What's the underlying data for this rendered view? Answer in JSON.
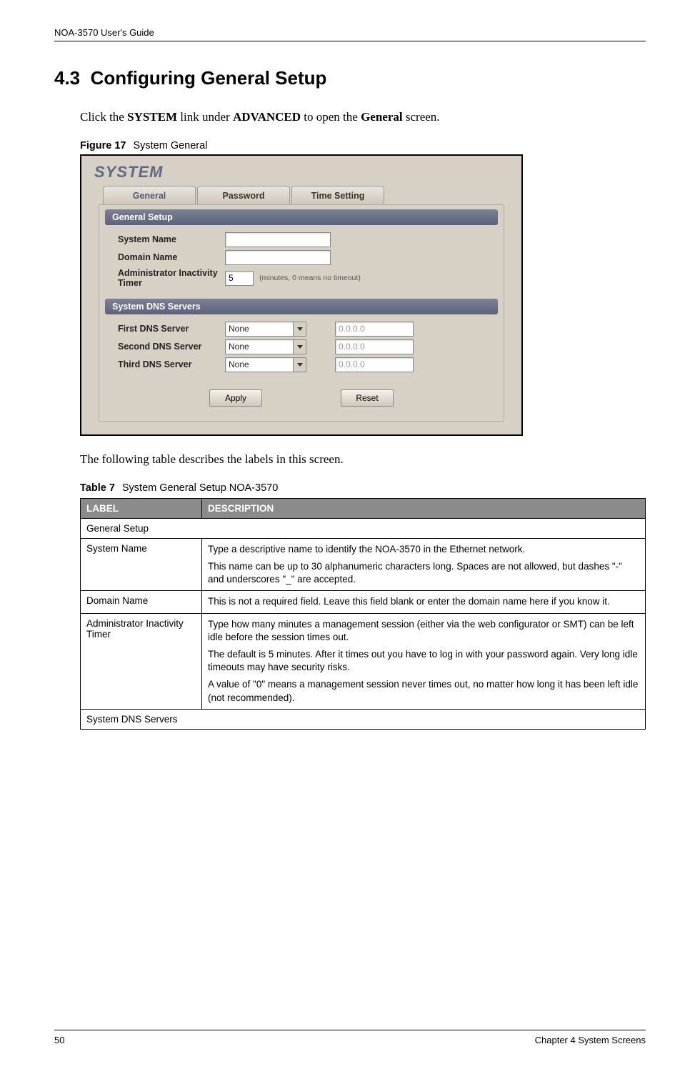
{
  "header": {
    "guide_title": "NOA-3570 User's Guide"
  },
  "section": {
    "number": "4.3",
    "title": "Configuring General Setup",
    "intro_pre": "Click the ",
    "intro_link1": "SYSTEM",
    "intro_mid1": " link under ",
    "intro_link2": "ADVANCED",
    "intro_mid2": " to open the ",
    "intro_link3": "General",
    "intro_post": " screen."
  },
  "figure": {
    "label": "Figure 17",
    "title": "System General"
  },
  "screenshot": {
    "heading": "SYSTEM",
    "tabs": {
      "general": "General",
      "password": "Password",
      "time": "Time Setting"
    },
    "sections": {
      "general_setup": "General Setup",
      "dns": "System DNS Servers"
    },
    "labels": {
      "system_name": "System Name",
      "domain_name": "Domain Name",
      "inactivity": "Administrator Inactivity Timer",
      "first_dns": "First DNS Server",
      "second_dns": "Second DNS Server",
      "third_dns": "Third DNS Server"
    },
    "values": {
      "inactivity": "5",
      "dns_select": "None",
      "dns_ip": "0.0.0.0"
    },
    "hint": "(minutes, 0 means no timeout)",
    "buttons": {
      "apply": "Apply",
      "reset": "Reset"
    }
  },
  "para_after_fig": "The following table describes the labels in this screen.",
  "table": {
    "label": "Table 7",
    "title": "System General Setup NOA-3570",
    "head": {
      "label": "LABEL",
      "desc": "DESCRIPTION"
    },
    "rows": {
      "r0": {
        "l": "General Setup"
      },
      "r1": {
        "l": "System Name",
        "d1": "Type a descriptive name to identify the NOA-3570 in the Ethernet network.",
        "d2": "This name can be up to 30 alphanumeric characters long. Spaces are not allowed, but dashes \"-\" and underscores \"_\" are accepted."
      },
      "r2": {
        "l": "Domain Name",
        "d1": "This is not a required field. Leave this field blank or enter the domain name here if you know it."
      },
      "r3": {
        "l": "Administrator Inactivity Timer",
        "d1": "Type how many minutes a management session (either via the web configurator or SMT) can be left idle before the session times out.",
        "d2": "The default is 5 minutes. After it times out you have to log in with your password again. Very long idle timeouts may have security risks.",
        "d3": "A value of \"0\" means a management session never times out, no matter how long it has been left idle (not recommended)."
      },
      "r4": {
        "l": "System DNS Servers"
      }
    }
  },
  "footer": {
    "page": "50",
    "chapter": "Chapter 4 System Screens"
  }
}
